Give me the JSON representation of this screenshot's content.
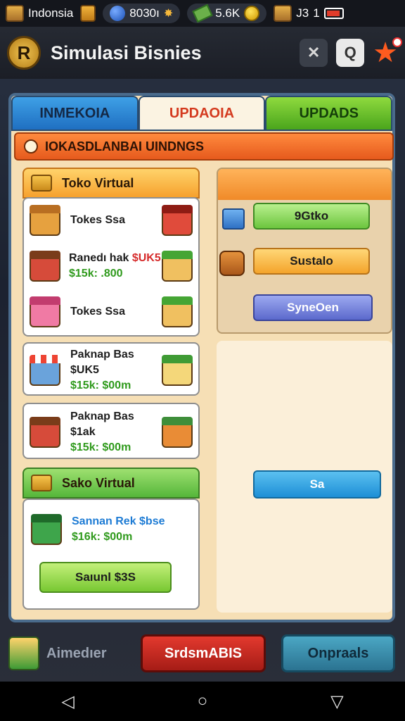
{
  "status_bar": {
    "country": "Indonsia",
    "gems": "8030ı",
    "cash": "5.6K",
    "level": "J3",
    "count": "1"
  },
  "header": {
    "logo_letter": "R",
    "title": "Simulasi Bisnies"
  },
  "tabs": [
    "INMEKOIA",
    "UPDAOIA",
    "UPDADS"
  ],
  "banner": "IOKASDLANBAI UINDNGS",
  "left_sections": {
    "toko_virtual": {
      "title": "Toko Virtual",
      "items": [
        {
          "name": "Tokes Ssa",
          "price": ""
        },
        {
          "name": "Ranedı hak",
          "tag": "$UK5",
          "price": "$15k: .800"
        },
        {
          "name": "Tokes Ssa",
          "price": ""
        }
      ]
    },
    "cards": [
      {
        "name": "Paknap Bas $UK5",
        "price": "$15k: $00m"
      },
      {
        "name": "Paknap Bas $1ak",
        "price": "$15k: $00m"
      }
    ],
    "sako_virtual": {
      "title": "Sako Virtual",
      "item_name": "Sannan Rek $bse",
      "item_price": "$16k: $00m",
      "button": "Saıunl $3S"
    }
  },
  "right_buttons": {
    "green": "9Gtko",
    "orange": "Sustalo",
    "blue": "SyneOen",
    "cyan": "Sa"
  },
  "bottom_bar": {
    "left_label": "Aimedıer",
    "red_button": "SrdsmABIS",
    "teal_button": "Onpraals"
  },
  "colors": {
    "tab_blue": "#1f6fc1",
    "tab_green": "#4aa51c",
    "banner_orange": "#e65a1d",
    "price_green": "#2f9a1c",
    "danger_red": "#a51c16"
  }
}
